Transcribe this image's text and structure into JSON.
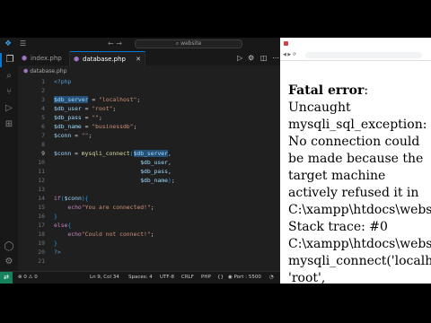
{
  "vscode": {
    "search_text": "website",
    "tabs": [
      {
        "label": "index.php"
      },
      {
        "label": "database.php"
      }
    ],
    "breadcrumb": "database.php",
    "code_lines": [
      {
        "n": "1",
        "tokens": [
          {
            "t": "<?php",
            "c": "t-tag"
          }
        ]
      },
      {
        "n": "2",
        "tokens": []
      },
      {
        "n": "3",
        "tokens": [
          {
            "t": "$db_server",
            "c": "t-var hl"
          },
          {
            "t": " = ",
            "c": "t-op"
          },
          {
            "t": "\"localhost\"",
            "c": "t-str"
          },
          {
            "t": ";",
            "c": "t-op"
          }
        ]
      },
      {
        "n": "4",
        "tokens": [
          {
            "t": "$db_user",
            "c": "t-var"
          },
          {
            "t": " = ",
            "c": "t-op"
          },
          {
            "t": "\"root\"",
            "c": "t-str"
          },
          {
            "t": ";",
            "c": "t-op"
          }
        ]
      },
      {
        "n": "5",
        "tokens": [
          {
            "t": "$db_pass",
            "c": "t-var"
          },
          {
            "t": " = ",
            "c": "t-op"
          },
          {
            "t": "\"\"",
            "c": "t-str"
          },
          {
            "t": ";",
            "c": "t-op"
          }
        ]
      },
      {
        "n": "6",
        "tokens": [
          {
            "t": "$db_name",
            "c": "t-var"
          },
          {
            "t": " = ",
            "c": "t-op"
          },
          {
            "t": "\"businessdb\"",
            "c": "t-str"
          },
          {
            "t": ";",
            "c": "t-op"
          }
        ]
      },
      {
        "n": "7",
        "tokens": [
          {
            "t": "$conn",
            "c": "t-var"
          },
          {
            "t": " = ",
            "c": "t-op"
          },
          {
            "t": "\"\"",
            "c": "t-str"
          },
          {
            "t": ";",
            "c": "t-op"
          }
        ]
      },
      {
        "n": "8",
        "tokens": []
      },
      {
        "n": "9",
        "tokens": [
          {
            "t": "$conn",
            "c": "t-var"
          },
          {
            "t": " = ",
            "c": "t-op"
          },
          {
            "t": "mysqli_connect",
            "c": "t-fn"
          },
          {
            "t": "(",
            "c": "t-brace2"
          },
          {
            "t": "$db_server",
            "c": "t-var hl"
          },
          {
            "t": ",",
            "c": "t-op"
          }
        ]
      },
      {
        "n": "10",
        "tokens": [
          {
            "t": "                         ",
            "c": "t-op"
          },
          {
            "t": "$db_user",
            "c": "t-var"
          },
          {
            "t": ",",
            "c": "t-op"
          }
        ]
      },
      {
        "n": "11",
        "tokens": [
          {
            "t": "                         ",
            "c": "t-op"
          },
          {
            "t": "$db_pass",
            "c": "t-var"
          },
          {
            "t": ",",
            "c": "t-op"
          }
        ]
      },
      {
        "n": "12",
        "tokens": [
          {
            "t": "                         ",
            "c": "t-op"
          },
          {
            "t": "$db_name",
            "c": "t-var"
          },
          {
            "t": ")",
            "c": "t-brace2"
          },
          {
            "t": ";",
            "c": "t-op"
          }
        ]
      },
      {
        "n": "13",
        "tokens": []
      },
      {
        "n": "14",
        "tokens": [
          {
            "t": "if",
            "c": "t-kw"
          },
          {
            "t": "(",
            "c": "t-brace2"
          },
          {
            "t": "$conn",
            "c": "t-var"
          },
          {
            "t": ")",
            "c": "t-brace2"
          },
          {
            "t": "{",
            "c": "t-brace2"
          }
        ]
      },
      {
        "n": "15",
        "tokens": [
          {
            "t": "    ",
            "c": "t-op"
          },
          {
            "t": "echo",
            "c": "t-kw"
          },
          {
            "t": "\"You are connected!\"",
            "c": "t-str"
          },
          {
            "t": ";",
            "c": "t-op"
          }
        ]
      },
      {
        "n": "16",
        "tokens": [
          {
            "t": "}",
            "c": "t-brace2"
          }
        ]
      },
      {
        "n": "17",
        "tokens": [
          {
            "t": "else",
            "c": "t-kw"
          },
          {
            "t": "{",
            "c": "t-brace2"
          }
        ]
      },
      {
        "n": "18",
        "tokens": [
          {
            "t": "    ",
            "c": "t-op"
          },
          {
            "t": "echo",
            "c": "t-kw"
          },
          {
            "t": "\"Could not connect!\"",
            "c": "t-str"
          },
          {
            "t": ";",
            "c": "t-op"
          }
        ]
      },
      {
        "n": "19",
        "tokens": [
          {
            "t": "}",
            "c": "t-brace2"
          }
        ]
      },
      {
        "n": "20",
        "tokens": [
          {
            "t": "?>",
            "c": "t-tag"
          }
        ]
      },
      {
        "n": "21",
        "tokens": []
      }
    ],
    "current_line": "9",
    "status": {
      "errors": "0",
      "warnings": "0",
      "position": "Ln 9, Col 34",
      "spaces": "Spaces: 4",
      "encoding": "UTF-8",
      "eol": "CRLF",
      "language": "PHP",
      "port": "Port : 5500"
    }
  },
  "browser": {
    "error_lines": [
      {
        "t": "Fatal error",
        "bold": true,
        "suffix": ":"
      },
      {
        "t": "Uncaught"
      },
      {
        "t": "mysqli_sql_exception:"
      },
      {
        "t": "No connection could"
      },
      {
        "t": "be made because the"
      },
      {
        "t": "target machine"
      },
      {
        "t": "actively refused it in"
      },
      {
        "t": "C:\\xampp\\htdocs\\websit"
      },
      {
        "t": "Stack trace: #0"
      },
      {
        "t": "C:\\xampp\\htdocs\\websit"
      },
      {
        "t": "mysqli_connect('localho"
      },
      {
        "t": "'root',"
      }
    ]
  },
  "colors": {
    "editor_bg": "#1f1f1f",
    "accent": "#0078d4",
    "remote_green": "#16825d"
  }
}
